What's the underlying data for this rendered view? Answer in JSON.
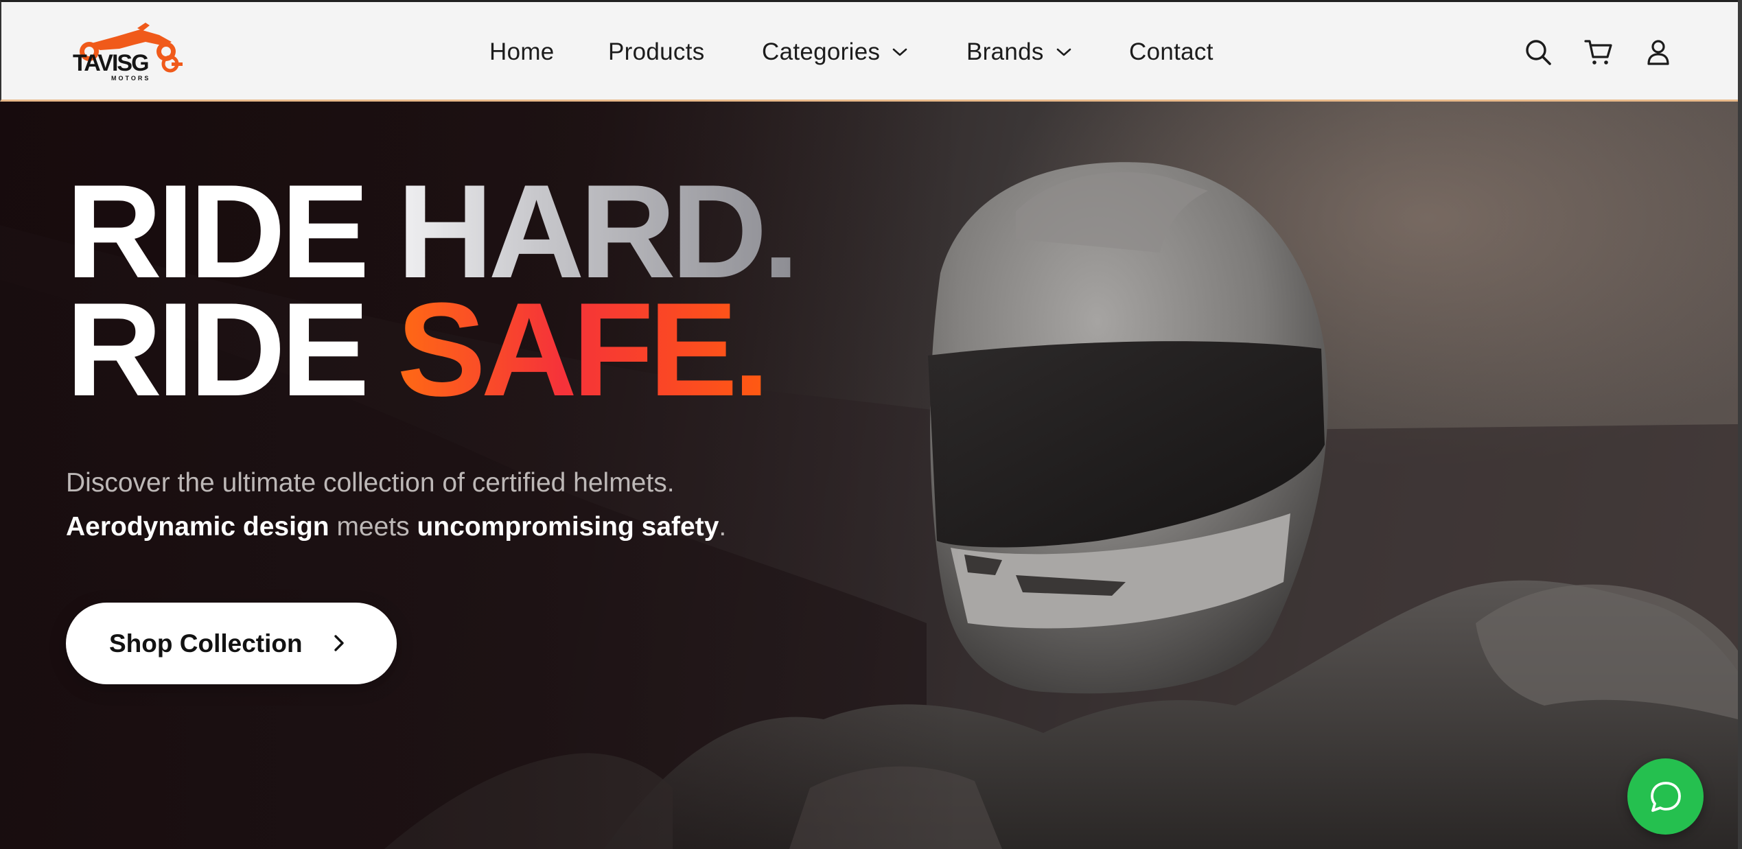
{
  "brand": {
    "logo_text": "TAVISGO",
    "logo_subtext": "MOTORS",
    "accent_color": "#f05a1a"
  },
  "nav": {
    "items": [
      {
        "label": "Home"
      },
      {
        "label": "Products"
      },
      {
        "label": "Categories",
        "has_dropdown": true
      },
      {
        "label": "Brands",
        "has_dropdown": true
      },
      {
        "label": "Contact"
      }
    ]
  },
  "header_icons": [
    "search-icon",
    "cart-icon",
    "user-icon"
  ],
  "hero": {
    "headline_line1_a": "RIDE ",
    "headline_line1_b": "HARD.",
    "headline_line2_a": "RIDE ",
    "headline_line2_b": "SAFE.",
    "sub_line1": "Discover the ultimate collection of certified helmets.",
    "sub_line2_a": "Aerodynamic design",
    "sub_line2_b": " meets ",
    "sub_line2_c": "uncompromising safety",
    "sub_line2_d": ".",
    "cta_label": "Shop Collection",
    "safe_gradient": [
      "#ff6a14",
      "#f5323a"
    ]
  },
  "chat_button": {
    "icon": "chat-bubble-icon",
    "color": "#25c04f"
  }
}
